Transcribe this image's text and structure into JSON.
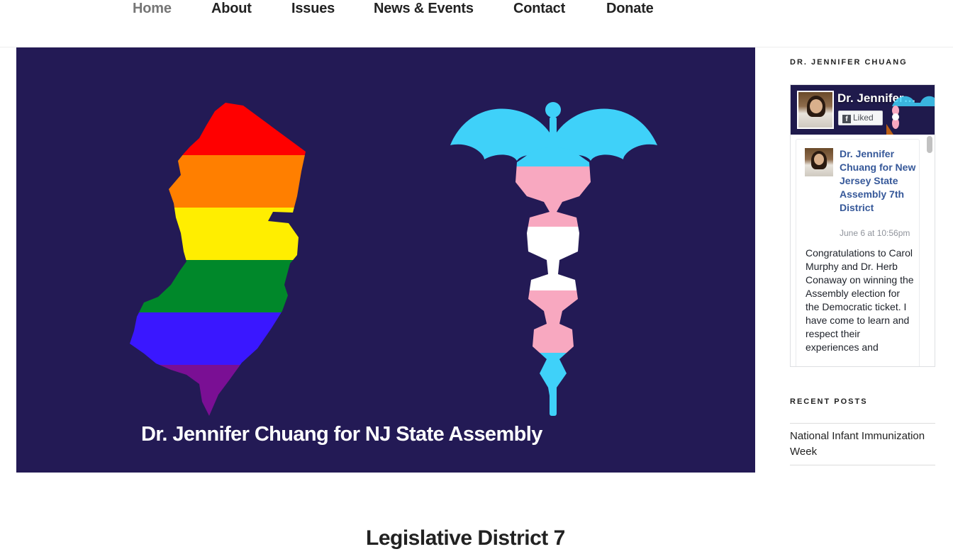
{
  "nav": {
    "items": [
      {
        "label": "Home",
        "active": true
      },
      {
        "label": "About",
        "active": false
      },
      {
        "label": "Issues",
        "active": false
      },
      {
        "label": "News & Events",
        "active": false
      },
      {
        "label": "Contact",
        "active": false
      },
      {
        "label": "Donate",
        "active": false
      }
    ]
  },
  "hero": {
    "caption": "Dr. Jennifer Chuang for NJ State Assembly",
    "background_color": "#231a55",
    "rainbow_colors": [
      "#ff0000",
      "#ff7f00",
      "#ffee00",
      "#00882a",
      "#3a17ff",
      "#7a0f94"
    ],
    "trans_colors": [
      "#3fd1f9",
      "#f8a8c0",
      "#ffffff"
    ]
  },
  "main": {
    "title": "Legislative District 7"
  },
  "sidebar": {
    "fb_widget": {
      "title": "DR. JENNIFER CHUANG",
      "page_name": "Dr. Jennifer Chuang for New Jersey State Assembly 7th District",
      "liked_label": "Liked",
      "liked_icon": "facebook-icon",
      "post": {
        "author": "Dr. Jennifer Chuang for New Jersey State Assembly 7th District",
        "time": "June 6 at 10:56pm",
        "text": "Congratulations to Carol Murphy and Dr. Herb Conaway on winning the Assembly election for the Democratic ticket. I have come to learn and respect their experiences and"
      }
    },
    "recent_posts": {
      "title": "RECENT POSTS",
      "items": [
        "National Infant Immunization Week"
      ]
    }
  }
}
